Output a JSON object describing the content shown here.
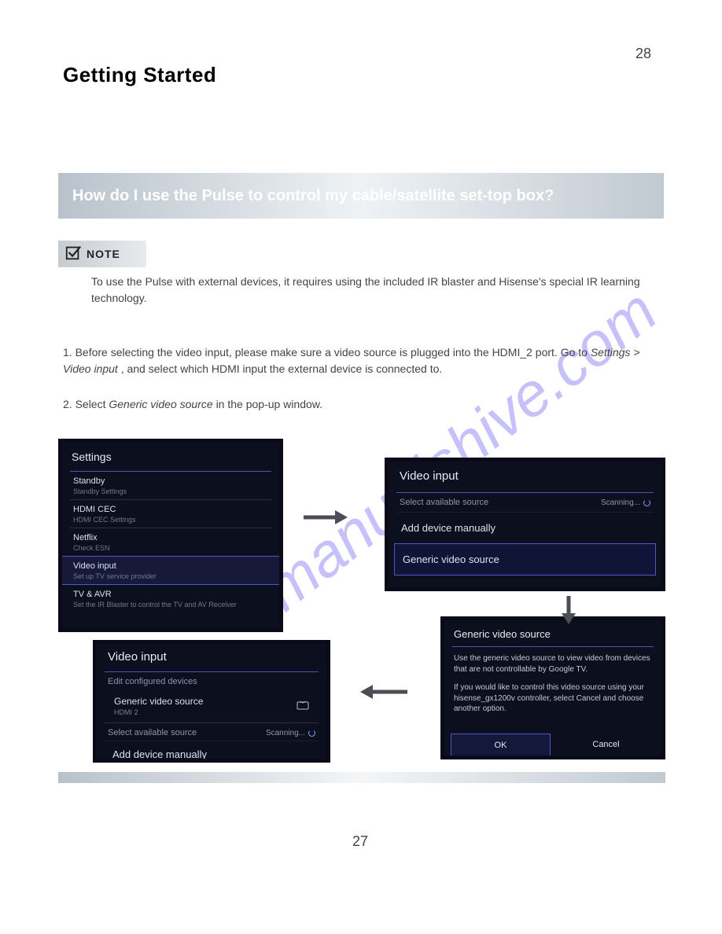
{
  "page": {
    "top_number": "28",
    "bottom_number": "27"
  },
  "header": "Getting Started",
  "banner": "How do I use the Pulse to control my cable/satellite set-top box?",
  "note": {
    "label": "NOTE",
    "text": "To use the Pulse with external devices, it requires using the included IR blaster and Hisense's special IR learning technology."
  },
  "intro": {
    "line1_a": "1. Before selecting the video input, please make sure a video source is plugged into the HDMI_2 port. Go to ",
    "line1_b": "Settings > Video input",
    "line1_c": ", and select which HDMI input the external device is connected to.",
    "line2_a": "2. Select ",
    "line2_b": "Generic video source",
    "line2_c": " in the pop-up window."
  },
  "panel1": {
    "title": "Settings",
    "items": [
      {
        "label": "Standby",
        "sub": "Standby Settings"
      },
      {
        "label": "HDMI CEC",
        "sub": "HDMI CEC Settings"
      },
      {
        "label": "Netflix",
        "sub": "Check ESN"
      },
      {
        "label": "Video input",
        "sub": "Set up TV service provider"
      },
      {
        "label": "TV & AVR",
        "sub": "Set the IR Blaster to control the TV and AV Receiver"
      }
    ]
  },
  "panel2": {
    "title": "Video input",
    "section": "Select available source",
    "scanning": "Scanning...",
    "opt1": "Add device manually",
    "opt2": "Generic video source"
  },
  "panel3": {
    "title": "Generic video source",
    "body1": "Use the generic video source to view video from devices that are not controllable by Google TV.",
    "body2": "If you would like to control this video source using your hisense_gx1200v controller, select Cancel and choose another option.",
    "ok": "OK",
    "cancel": "Cancel"
  },
  "panel4": {
    "title": "Video input",
    "section1": "Edit configured devices",
    "item_label": "Generic video source",
    "item_sub": "HDMI 2",
    "section2": "Select available source",
    "scanning": "Scanning...",
    "opt1": "Add device manually"
  },
  "watermark": "manualshive.com"
}
